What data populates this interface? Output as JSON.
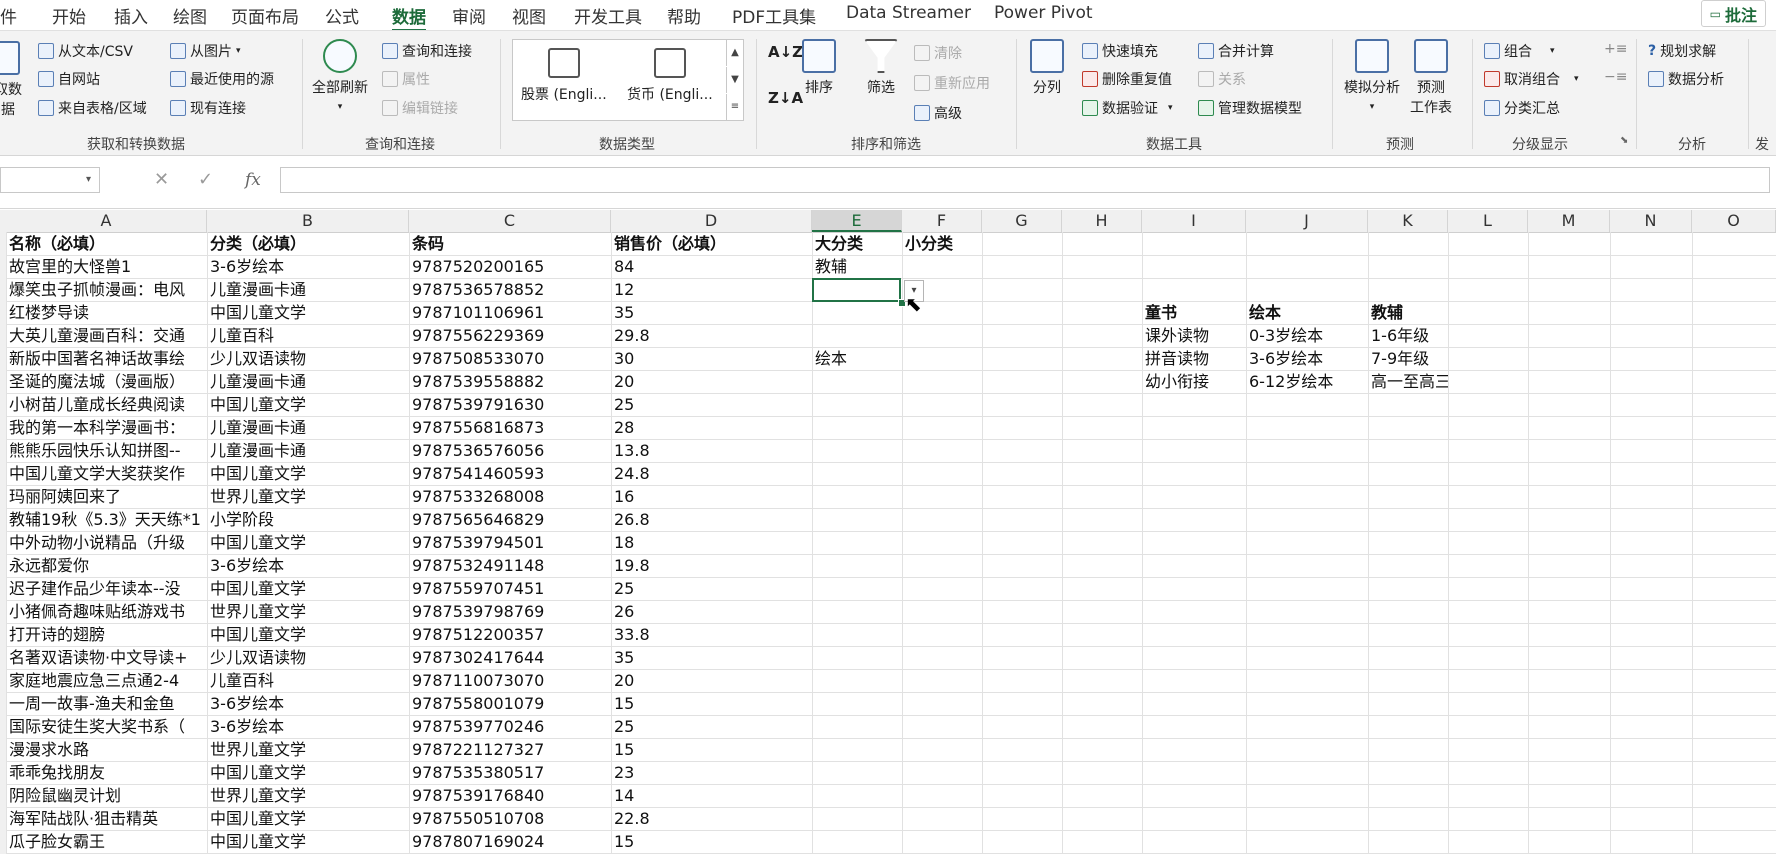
{
  "tabs": [
    "文件",
    "开始",
    "插入",
    "绘图",
    "页面布局",
    "公式",
    "数据",
    "审阅",
    "视图",
    "开发工具",
    "帮助",
    "PDF工具集",
    "Data Streamer",
    "Power Pivot"
  ],
  "tab_display": [
    "件",
    "开始",
    "插入",
    "绘图",
    "页面布局",
    "公式",
    "数据",
    "审阅",
    "视图",
    "开发工具",
    "帮助",
    "PDF工具集",
    "Data Streamer",
    "Power Pivot"
  ],
  "active_tab": "数据",
  "comment_button": "批注",
  "ribbon": {
    "get_data": {
      "label_line1": "取数",
      "label_line2": "据"
    },
    "from_text_csv": "从文本/CSV",
    "from_web": "自网站",
    "from_table": "来自表格/区域",
    "from_picture": "从图片",
    "recent_sources": "最近使用的源",
    "existing_connections": "现有连接",
    "group_get_transform": "获取和转换数据",
    "refresh_all": "全部刷新",
    "queries_connections": "查询和连接",
    "properties": "属性",
    "edit_links": "编辑链接",
    "group_queries": "查询和连接",
    "stocks": "股票 (Engli...",
    "currencies": "货币 (Engli...",
    "group_datatypes": "数据类型",
    "sort": "排序",
    "filter": "筛选",
    "clear": "清除",
    "reapply": "重新应用",
    "advanced": "高级",
    "group_sort_filter": "排序和筛选",
    "text_to_columns": "分列",
    "flash_fill": "快速填充",
    "remove_duplicates": "删除重复值",
    "data_validation": "数据验证",
    "consolidate": "合并计算",
    "relationships": "关系",
    "manage_data_model": "管理数据模型",
    "group_data_tools": "数据工具",
    "what_if": "模拟分析",
    "forecast_sheet_line1": "预测",
    "forecast_sheet_line2": "工作表",
    "group_forecast": "预测",
    "group_btn": "组合",
    "ungroup_btn": "取消组合",
    "subtotal": "分类汇总",
    "group_outline": "分级显示",
    "solver": "规划求解",
    "data_analysis": "数据分析",
    "group_analysis": "分析",
    "group_partial": "发"
  },
  "formula_bar": {
    "name_box": "",
    "formula": "",
    "fx": "fx"
  },
  "columns": [
    "A",
    "B",
    "C",
    "D",
    "E",
    "F",
    "G",
    "H",
    "I",
    "J",
    "K",
    "L",
    "M",
    "N",
    "O"
  ],
  "selected_column": "E",
  "header_row": [
    "名称（必填）",
    "分类（必填）",
    "条码",
    "销售价（必填）",
    "大分类",
    "小分类"
  ],
  "rows": [
    [
      "故宫里的大怪兽1",
      "3-6岁绘本",
      "9787520200165",
      "84"
    ],
    [
      "爆笑虫子抓帧漫画：电风",
      "儿童漫画卡通",
      "9787536578852",
      "12"
    ],
    [
      "红楼梦导读",
      "中国儿童文学",
      "9787101106961",
      "35"
    ],
    [
      "大英儿童漫画百科：交通",
      "儿童百科",
      "9787556229369",
      "29.8"
    ],
    [
      "新版中国著名神话故事绘",
      "少儿双语读物",
      "9787508533070",
      "30"
    ],
    [
      "圣诞的魔法城（漫画版）",
      "儿童漫画卡通",
      "9787539558882",
      "20"
    ],
    [
      "小树苗儿童成长经典阅读",
      "中国儿童文学",
      "9787539791630",
      "25"
    ],
    [
      "我的第一本科学漫画书：",
      "儿童漫画卡通",
      "9787556816873",
      "28"
    ],
    [
      "熊熊乐园快乐认知拼图--",
      "儿童漫画卡通",
      "9787536576056",
      "13.8"
    ],
    [
      "中国儿童文学大奖获奖作",
      "中国儿童文学",
      "9787541460593",
      "24.8"
    ],
    [
      "玛丽阿姨回来了",
      "世界儿童文学",
      "9787533268008",
      "16"
    ],
    [
      "教辅19秋《5.3》天天练*1",
      "小学阶段",
      "9787565646829",
      "26.8"
    ],
    [
      "中外动物小说精品（升级",
      "中国儿童文学",
      "9787539794501",
      "18"
    ],
    [
      "永远都爱你",
      "3-6岁绘本",
      "9787532491148",
      "19.8"
    ],
    [
      "迟子建作品少年读本--没",
      "中国儿童文学",
      "9787559707451",
      "25"
    ],
    [
      "小猪佩奇趣味贴纸游戏书",
      "世界儿童文学",
      "9787539798769",
      "26"
    ],
    [
      "打开诗的翅膀",
      "中国儿童文学",
      "9787512200357",
      "33.8"
    ],
    [
      "名著双语读物·中文导读+",
      "少儿双语读物",
      "9787302417644",
      "35"
    ],
    [
      "家庭地震应急三点通2-4",
      "儿童百科",
      "9787110073070",
      "20"
    ],
    [
      "一周一故事-渔夫和金鱼",
      "3-6岁绘本",
      "9787558001079",
      "15"
    ],
    [
      "国际安徒生奖大奖书系（",
      "3-6岁绘本",
      "9787539770246",
      "25"
    ],
    [
      "漫漫求水路",
      "世界儿童文学",
      "9787221127327",
      "15"
    ],
    [
      "乖乖兔找朋友",
      "中国儿童文学",
      "9787535380517",
      "23"
    ],
    [
      "阴险鼠幽灵计划",
      "世界儿童文学",
      "9787539176840",
      "14"
    ],
    [
      "海军陆战队·狙击精英",
      "中国儿童文学",
      "9787550510708",
      "22.8"
    ],
    [
      "瓜子脸女霸王",
      "中国儿童文学",
      "9787807169024",
      "15"
    ]
  ],
  "e_column_values": {
    "row1": "教辅",
    "row5": "绘本"
  },
  "lookup_table": {
    "headers": [
      "童书",
      "绘本",
      "教辅"
    ],
    "rows": [
      [
        "课外读物",
        "0-3岁绘本",
        "1-6年级"
      ],
      [
        "拼音读物",
        "3-6岁绘本",
        "7-9年级"
      ],
      [
        "幼小衔接",
        "6-12岁绘本",
        "高一至高三"
      ]
    ]
  }
}
